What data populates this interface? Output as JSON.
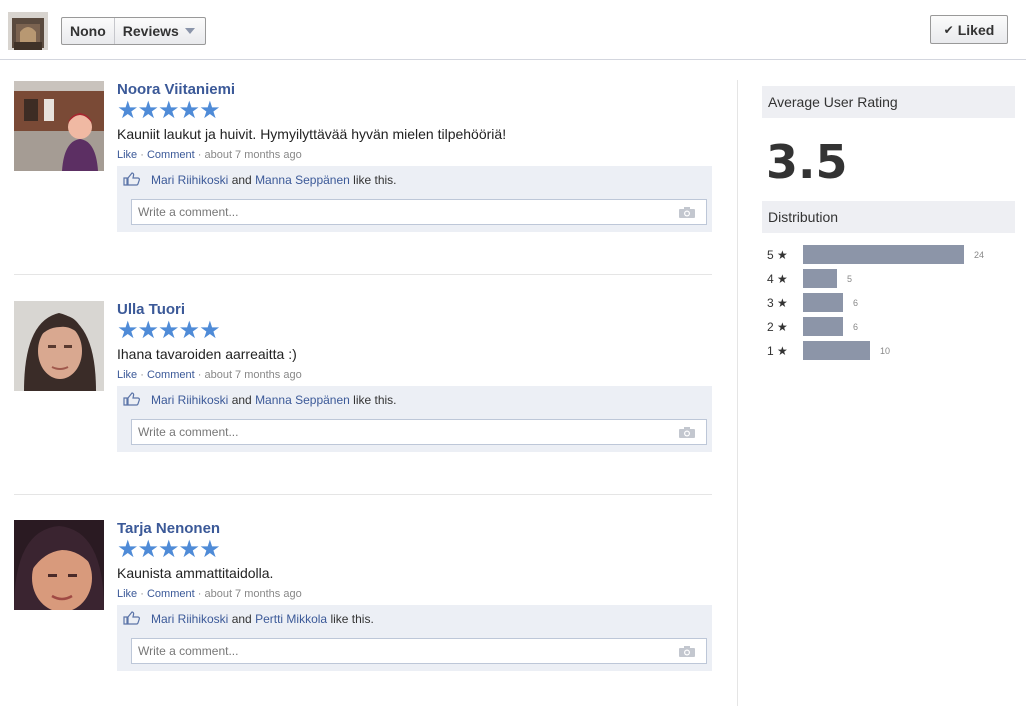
{
  "header": {
    "page_name": "Nono",
    "section": "Reviews",
    "liked_label": "Liked"
  },
  "reviews": [
    {
      "author": "Noora Viitaniemi",
      "stars": "★★★★★",
      "text": "Kauniit laukut ja huivit. Hymyilyttävää hyvän mielen tilpehööriä!",
      "like": "Like",
      "comment": "Comment",
      "time": "about 7 months ago",
      "liker1": "Mari Riihikoski",
      "and": "and",
      "liker2": "Manna Seppänen",
      "like_this": "like this.",
      "comment_placeholder": "Write a comment..."
    },
    {
      "author": "Ulla Tuori",
      "stars": "★★★★★",
      "text": "Ihana tavaroiden aarreaitta :)",
      "like": "Like",
      "comment": "Comment",
      "time": "about 7 months ago",
      "liker1": "Mari Riihikoski",
      "and": "and",
      "liker2": "Manna Seppänen",
      "like_this": "like this.",
      "comment_placeholder": "Write a comment..."
    },
    {
      "author": "Tarja Nenonen",
      "stars": "★★★★★",
      "text": "Kaunista ammattitaidolla.",
      "like": "Like",
      "comment": "Comment",
      "time": "about 7 months ago",
      "liker1": "Mari Riihikoski",
      "and": "and",
      "liker2": "Pertti Mikkola",
      "like_this": "like this.",
      "comment_placeholder": "Write a comment..."
    }
  ],
  "sidebar": {
    "avg_title": "Average User Rating",
    "avg_value": "3.5",
    "dist_title": "Distribution",
    "distribution": [
      {
        "label": "5 ★",
        "count": "24",
        "value": 24
      },
      {
        "label": "4 ★",
        "count": "5",
        "value": 5
      },
      {
        "label": "3 ★",
        "count": "6",
        "value": 6
      },
      {
        "label": "2 ★",
        "count": "6",
        "value": 6
      },
      {
        "label": "1 ★",
        "count": "10",
        "value": 10
      }
    ]
  },
  "colors": {
    "link": "#3b5998",
    "star": "#4f8bd7",
    "bar": "#8c95a8",
    "panel": "#eceff5"
  },
  "icons": [
    "thumbs-up-icon",
    "camera-icon",
    "checkmark-icon",
    "chevron-down-icon"
  ]
}
